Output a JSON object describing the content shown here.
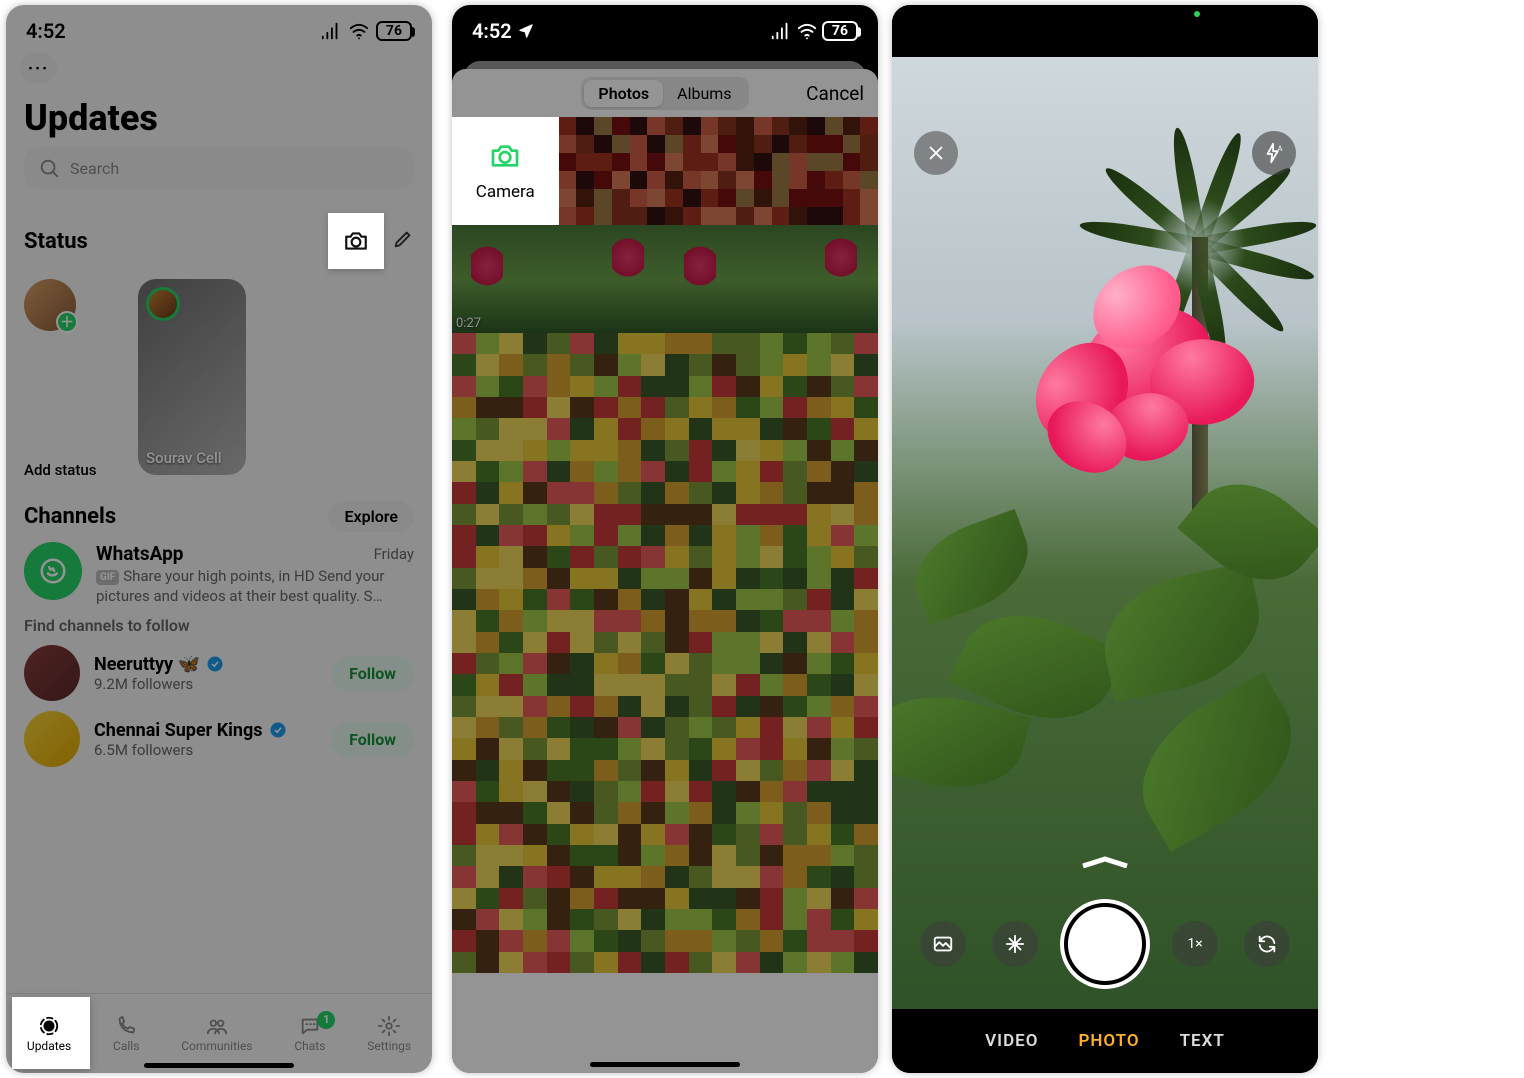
{
  "screen1": {
    "statusbar": {
      "time": "4:52",
      "battery": "76"
    },
    "title": "Updates",
    "search": {
      "placeholder": "Search"
    },
    "status": {
      "header": "Status",
      "add_label": "Add status",
      "cards": [
        {
          "name": "Sourav Cell"
        }
      ]
    },
    "channels": {
      "header": "Channels",
      "explore": "Explore",
      "items": [
        {
          "name": "WhatsApp",
          "time": "Friday",
          "badge": "GIF",
          "msg": "Share your high points, in HD Send your pictures and videos at their best quality. S…"
        }
      ],
      "find_label": "Find channels to follow",
      "suggested": [
        {
          "name": "Neeruttyy 🦋",
          "followers": "9.2M followers",
          "verified": true,
          "follow": "Follow"
        },
        {
          "name": "Chennai Super Kings",
          "followers": "6.5M followers",
          "verified": true,
          "follow": "Follow"
        }
      ]
    },
    "tabs": [
      {
        "label": "Updates",
        "active": true
      },
      {
        "label": "Calls"
      },
      {
        "label": "Communities"
      },
      {
        "label": "Chats",
        "badge": "1"
      },
      {
        "label": "Settings"
      }
    ]
  },
  "screen2": {
    "statusbar": {
      "time": "4:52",
      "battery": "76"
    },
    "segmented": {
      "photos": "Photos",
      "albums": "Albums"
    },
    "cancel": "Cancel",
    "camera_cell": "Camera",
    "video_duration": "0:27"
  },
  "screen3": {
    "zoom": "1×",
    "modes": {
      "video": "VIDEO",
      "photo": "PHOTO",
      "text": "TEXT"
    }
  }
}
